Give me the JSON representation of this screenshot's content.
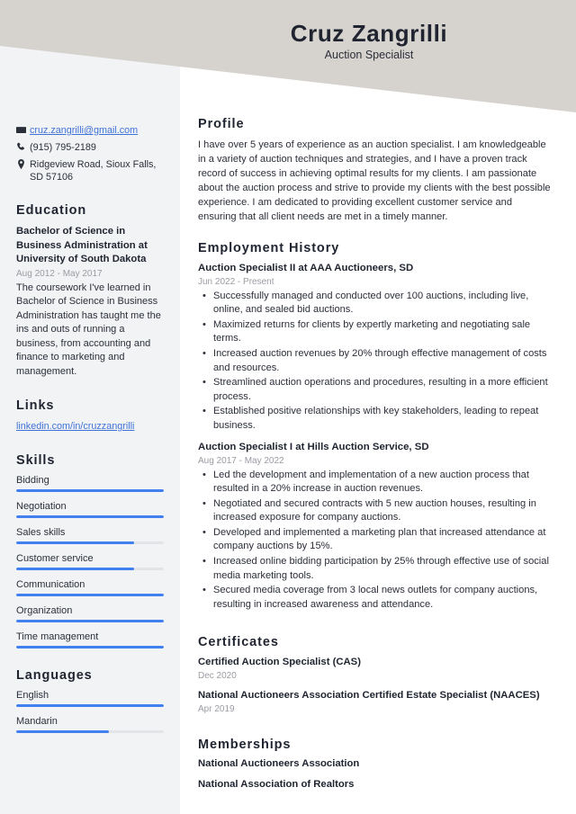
{
  "theme": {
    "header_bg": "#d6d2cd",
    "sidebar_bg": "#f2f3f5",
    "accent": "#4380ef",
    "link": "#3f72d8",
    "text": "#2b2f3a",
    "muted": "#9a9ca3"
  },
  "header": {
    "name": "Cruz Zangrilli",
    "job_title": "Auction Specialist"
  },
  "contact": {
    "items": [
      {
        "icon": "envelope-icon",
        "text": "cruz.zangrilli@gmail.com",
        "is_link": true
      },
      {
        "icon": "phone-icon",
        "text": "(915) 795-2189",
        "is_link": false
      },
      {
        "icon": "location-pin-icon",
        "text": "Ridgeview Road, Sioux Falls, SD 57106",
        "is_link": false
      }
    ]
  },
  "education": {
    "heading": "Education",
    "entries": [
      {
        "title": "Bachelor of Science in Business Administration at University of South Dakota",
        "date": "Aug 2012 - May 2017",
        "description": "The coursework I've learned in Bachelor of Science in Business Administration has taught me the ins and outs of running a business, from accounting and finance to marketing and management."
      }
    ]
  },
  "links": {
    "heading": "Links",
    "items": [
      {
        "label": "linkedin.com/in/cruzzangrilli"
      }
    ]
  },
  "skills": {
    "heading": "Skills",
    "items": [
      {
        "label": "Bidding",
        "level": 100
      },
      {
        "label": "Negotiation",
        "level": 100
      },
      {
        "label": "Sales skills",
        "level": 80
      },
      {
        "label": "Customer service",
        "level": 80
      },
      {
        "label": "Communication",
        "level": 100
      },
      {
        "label": "Organization",
        "level": 100
      },
      {
        "label": "Time management",
        "level": 100
      }
    ]
  },
  "languages": {
    "heading": "Languages",
    "items": [
      {
        "label": "English",
        "level": 100
      },
      {
        "label": "Mandarin",
        "level": 63
      }
    ]
  },
  "profile": {
    "heading": "Profile",
    "text": "I have over 5 years of experience as an auction specialist. I am knowledgeable in a variety of auction techniques and strategies, and I have a proven track record of success in achieving optimal results for my clients. I am passionate about the auction process and strive to provide my clients with the best possible experience. I am dedicated to providing excellent customer service and ensuring that all client needs are met in a timely manner."
  },
  "employment": {
    "heading": "Employment History",
    "jobs": [
      {
        "title": "Auction Specialist II at AAA Auctioneers, SD",
        "date": "Jun 2022 - Present",
        "bullets": [
          "Successfully managed and conducted over 100 auctions, including live, online, and sealed bid auctions.",
          "Maximized returns for clients by expertly marketing and negotiating sale terms.",
          "Increased auction revenues by 20% through effective management of costs and resources.",
          "Streamlined auction operations and procedures, resulting in a more efficient process.",
          "Established positive relationships with key stakeholders, leading to repeat business."
        ]
      },
      {
        "title": "Auction Specialist I at Hills Auction Service, SD",
        "date": "Aug 2017 - May 2022",
        "bullets": [
          "Led the development and implementation of a new auction process that resulted in a 20% increase in auction revenues.",
          "Negotiated and secured contracts with 5 new auction houses, resulting in increased exposure for company auctions.",
          "Developed and implemented a marketing plan that increased attendance at company auctions by 15%.",
          "Increased online bidding participation by 25% through effective use of social media marketing tools.",
          "Secured media coverage from 3 local news outlets for company auctions, resulting in increased awareness and attendance."
        ]
      }
    ]
  },
  "certificates": {
    "heading": "Certificates",
    "items": [
      {
        "title": "Certified Auction Specialist (CAS)",
        "date": "Dec 2020"
      },
      {
        "title": "National Auctioneers Association Certified Estate Specialist (NAACES)",
        "date": "Apr 2019"
      }
    ]
  },
  "memberships": {
    "heading": "Memberships",
    "items": [
      {
        "label": "National Auctioneers Association"
      },
      {
        "label": "National Association of Realtors"
      }
    ]
  }
}
